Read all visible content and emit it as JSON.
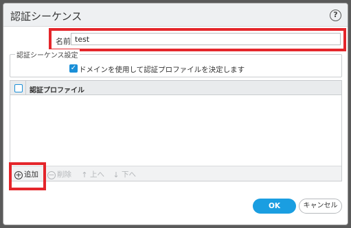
{
  "dialog": {
    "title": "認証シーケンス",
    "help_icon": "question-circle-icon"
  },
  "name_field": {
    "label": "名前",
    "value": "test"
  },
  "settings": {
    "legend": "認証シーケンス設定",
    "checkbox_label": "ドメインを使用して認証プロファイルを決定します",
    "checkbox_checked": true
  },
  "profile_table": {
    "column_header": "認証プロファイル",
    "rows": []
  },
  "toolbar": {
    "add_label": "追加",
    "delete_label": "削除",
    "up_label": "上へ",
    "down_label": "下へ"
  },
  "footer": {
    "ok_label": "OK",
    "cancel_label": "キャンセル"
  },
  "colors": {
    "accent": "#1a9ee1",
    "highlight": "#e4262b"
  }
}
